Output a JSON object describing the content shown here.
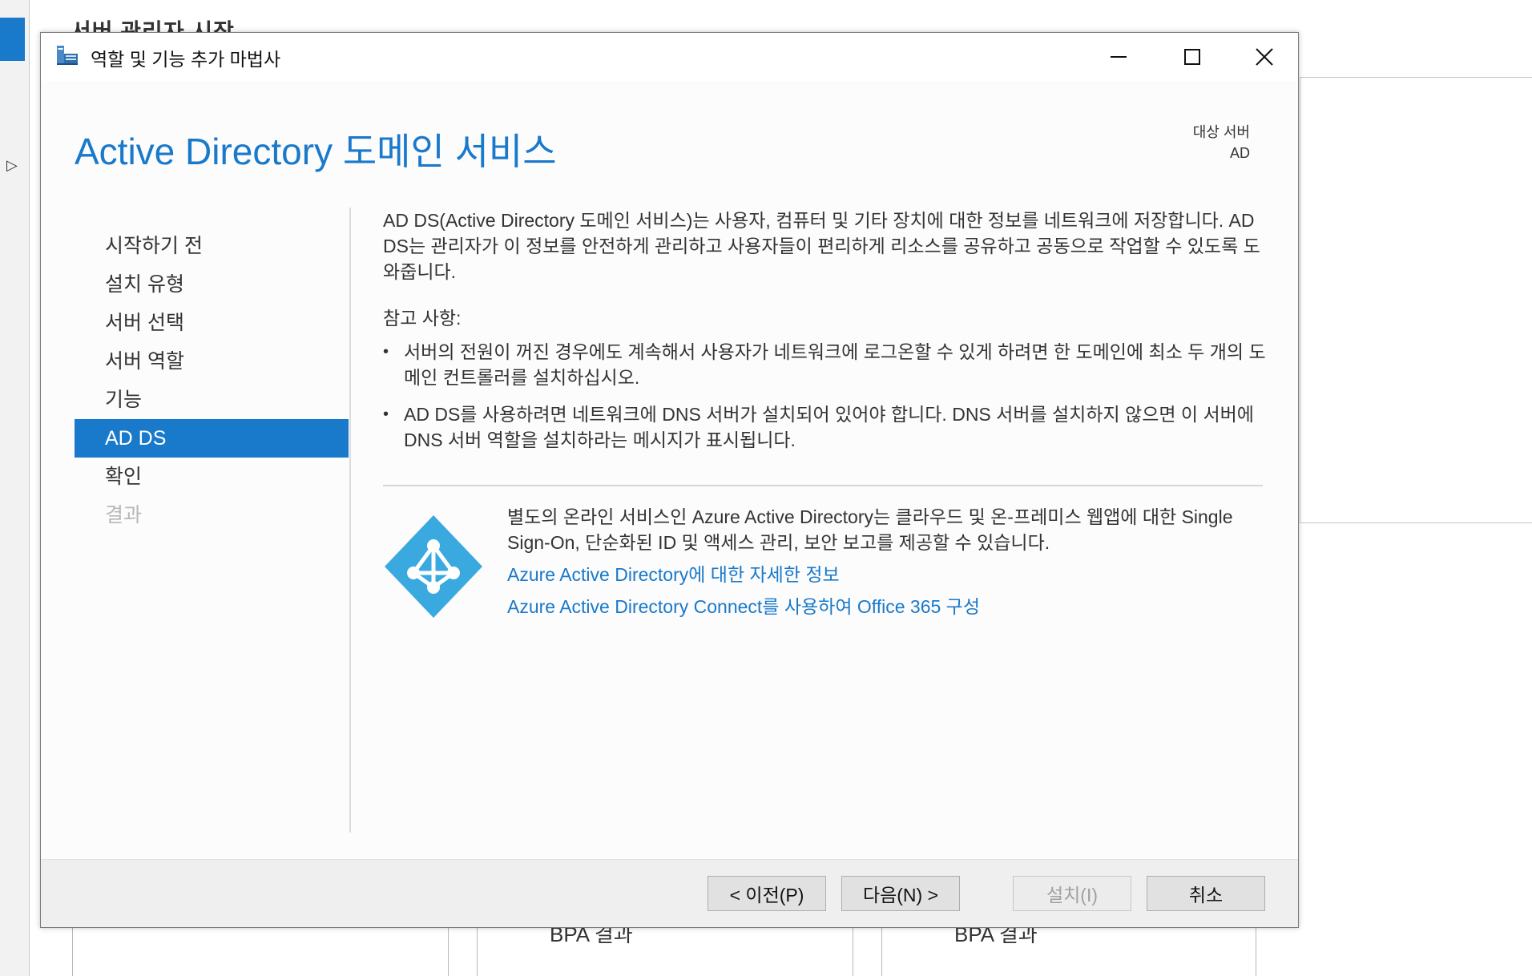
{
  "background": {
    "title": "서버 관리자 시작",
    "bpa_left": "BPA 결과",
    "bpa_right": "BPA 결과"
  },
  "window": {
    "title": "역할 및 기능 추가 마법사",
    "heading": "Active Directory 도메인 서비스",
    "target_server_label": "대상 서버",
    "target_server_value": "AD"
  },
  "nav": {
    "items": [
      {
        "label": "시작하기 전"
      },
      {
        "label": "설치 유형"
      },
      {
        "label": "서버 선택"
      },
      {
        "label": "서버 역할"
      },
      {
        "label": "기능"
      },
      {
        "label": "AD DS"
      },
      {
        "label": "확인"
      },
      {
        "label": "결과"
      }
    ],
    "active_index": 5
  },
  "content": {
    "intro": "AD DS(Active Directory 도메인 서비스)는 사용자, 컴퓨터 및 기타 장치에 대한 정보를 네트워크에 저장합니다. AD DS는 관리자가 이 정보를 안전하게 관리하고 사용자들이 편리하게 리소스를 공유하고 공동으로 작업할 수 있도록 도와줍니다.",
    "notes_heading": "참고 사항:",
    "notes": [
      "서버의 전원이 꺼진 경우에도 계속해서 사용자가 네트워크에 로그온할 수 있게 하려면 한 도메인에 최소 두 개의 도메인 컨트롤러를 설치하십시오.",
      "AD DS를 사용하려면 네트워크에 DNS 서버가 설치되어 있어야 합니다. DNS 서버를 설치하지 않으면 이 서버에 DNS 서버 역할을 설치하라는 메시지가 표시됩니다."
    ],
    "azure_desc": "별도의 온라인 서비스인 Azure Active Directory는 클라우드 및 온-프레미스 웹앱에 대한 Single Sign-On, 단순화된 ID 및 액세스 관리, 보안 보고를 제공할 수 있습니다.",
    "azure_link_1": "Azure Active Directory에 대한 자세한 정보",
    "azure_link_2": "Azure Active Directory Connect를 사용하여 Office 365 구성"
  },
  "buttons": {
    "prev": "< 이전(P)",
    "next": "다음(N) >",
    "install": "설치(I)",
    "cancel": "취소"
  },
  "colors": {
    "accent": "#1979ca",
    "azure_logo": "#3aa9df",
    "disabled_text": "#b7b7b7"
  }
}
